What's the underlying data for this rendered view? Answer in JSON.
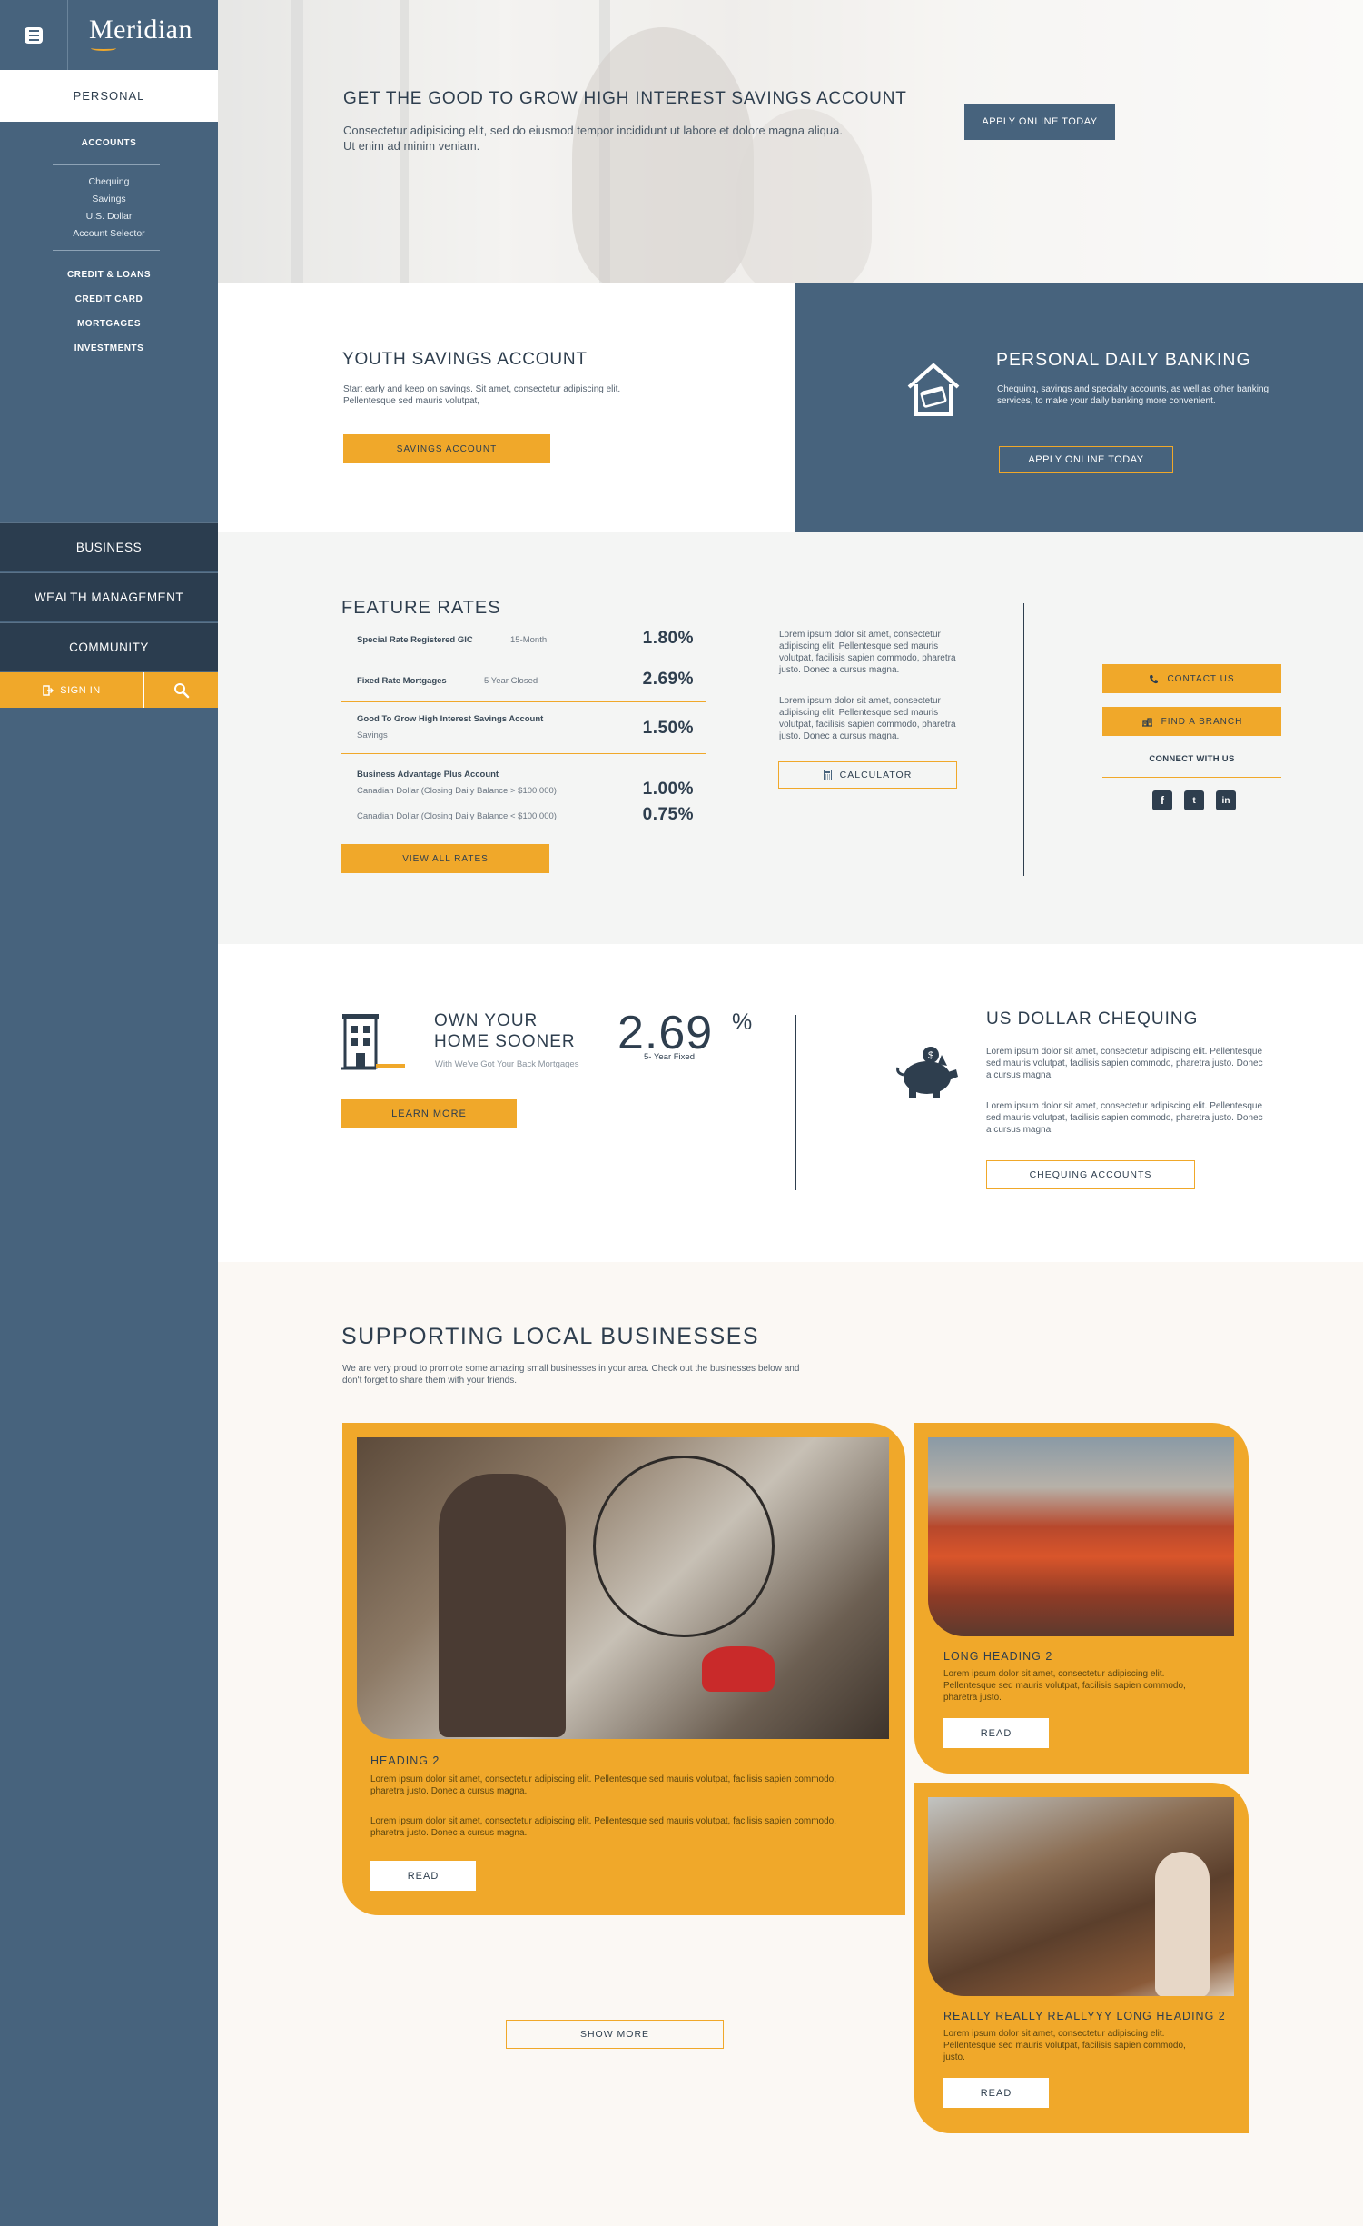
{
  "brand": {
    "name": "Meridian"
  },
  "sidebar": {
    "personal_tab": "PERSONAL",
    "accounts_heading": "ACCOUNTS",
    "account_links": [
      "Chequing",
      "Savings",
      "U.S. Dollar",
      "Account Selector"
    ],
    "categories": [
      "CREDIT & LOANS",
      "CREDIT CARD",
      "MORTGAGES",
      "INVESTMENTS"
    ],
    "sections": [
      "BUSINESS",
      "WEALTH MANAGEMENT",
      "COMMUNITY"
    ],
    "sign_in": "SIGN IN"
  },
  "hero": {
    "title": "GET THE GOOD TO GROW HIGH INTEREST SAVINGS ACCOUNT",
    "text": "Consectetur adipisicing elit, sed do eiusmod tempor incididunt ut labore et dolore magna aliqua. Ut enim ad minim veniam.",
    "cta": "APPLY ONLINE TODAY"
  },
  "youth": {
    "title": "YOUTH SAVINGS ACCOUNT",
    "text": "Start early and keep on savings. Sit amet, consectetur adipiscing elit. Pellentesque sed mauris volutpat,",
    "cta": "SAVINGS  ACCOUNT"
  },
  "daily": {
    "title": "PERSONAL DAILY BANKING",
    "text": "Chequing, savings and specialty accounts, as well as other banking services, to make your daily banking more convenient.",
    "cta": "APPLY ONLINE TODAY"
  },
  "rates": {
    "title": "FEATURE RATES",
    "rows": [
      {
        "name": "Special Rate Registered GIC",
        "term": "15-Month",
        "value": "1.80%"
      },
      {
        "name": "Fixed Rate Mortgages",
        "term": "5 Year Closed",
        "value": "2.69%"
      },
      {
        "name": "Good To Grow High Interest Savings Account",
        "term": "Savings",
        "value": "1.50%"
      },
      {
        "name": "Business Advantage Plus Account",
        "term": "Canadian Dollar (Closing Daily Balance > $100,000)",
        "value": "1.00%",
        "term2": "Canadian Dollar (Closing Daily Balance < $100,000)",
        "value2": "0.75%"
      }
    ],
    "cta": "VIEW ALL RATES",
    "para1": "Lorem ipsum dolor sit amet, consectetur adipiscing elit. Pellentesque sed mauris volutpat, facilisis sapien commodo, pharetra justo. Donec a cursus magna.",
    "para2": "Lorem ipsum dolor sit amet, consectetur adipiscing elit. Pellentesque sed mauris volutpat, facilisis sapien commodo, pharetra justo. Donec a cursus magna.",
    "calculator": "CALCULATOR",
    "contact": "CONTACT US",
    "branch": "FIND A BRANCH",
    "connect": "CONNECT WITH US",
    "social": [
      "f",
      "t",
      "in"
    ]
  },
  "home": {
    "title_line1": "OWN YOUR",
    "title_line2": "HOME SOONER",
    "subtitle": "With We've Got Your Back Mortgages",
    "rate": "2.69",
    "rate_pct": "%",
    "rate_label": "5- Year Fixed",
    "cta": "LEARN MORE"
  },
  "usd": {
    "title": "US DOLLAR CHEQUING",
    "para1": "Lorem ipsum dolor sit amet, consectetur adipiscing elit. Pellentesque sed mauris volutpat, facilisis sapien commodo, pharetra justo. Donec a cursus magna.",
    "para2": "Lorem ipsum dolor sit amet, consectetur adipiscing elit. Pellentesque sed mauris volutpat, facilisis sapien commodo, pharetra justo. Donec a cursus magna.",
    "cta": "CHEQUING ACCOUNTS"
  },
  "local": {
    "title": "SUPPORTING LOCAL BUSINESSES",
    "text": "We are very proud to promote some amazing small businesses in your area. Check out the businesses below and don't forget to share them with your friends.",
    "cards": [
      {
        "heading": "HEADING 2",
        "para1": "Lorem ipsum dolor sit amet, consectetur adipiscing elit. Pellentesque sed mauris volutpat, facilisis sapien commodo, pharetra justo. Donec a cursus magna.",
        "para2": "Lorem ipsum dolor sit amet, consectetur adipiscing elit. Pellentesque sed mauris volutpat, facilisis sapien commodo, pharetra justo. Donec a cursus magna.",
        "cta": "READ"
      },
      {
        "heading": "LONG HEADING 2",
        "para1": "Lorem ipsum dolor sit amet, consectetur adipiscing elit. Pellentesque sed mauris volutpat, facilisis sapien commodo, pharetra justo.",
        "cta": "READ"
      },
      {
        "heading": "REALLY REALLY REALLYYY LONG HEADING 2",
        "para1": "Lorem ipsum dolor sit amet, consectetur adipiscing elit. Pellentesque sed mauris volutpat, facilisis sapien commodo, justo.",
        "cta": "READ"
      }
    ],
    "show_more": "SHOW MORE"
  },
  "colors": {
    "navy": "#47637d",
    "dark_navy": "#2b3d4f",
    "accent": "#f0a82a",
    "text": "#2e3e4e"
  }
}
